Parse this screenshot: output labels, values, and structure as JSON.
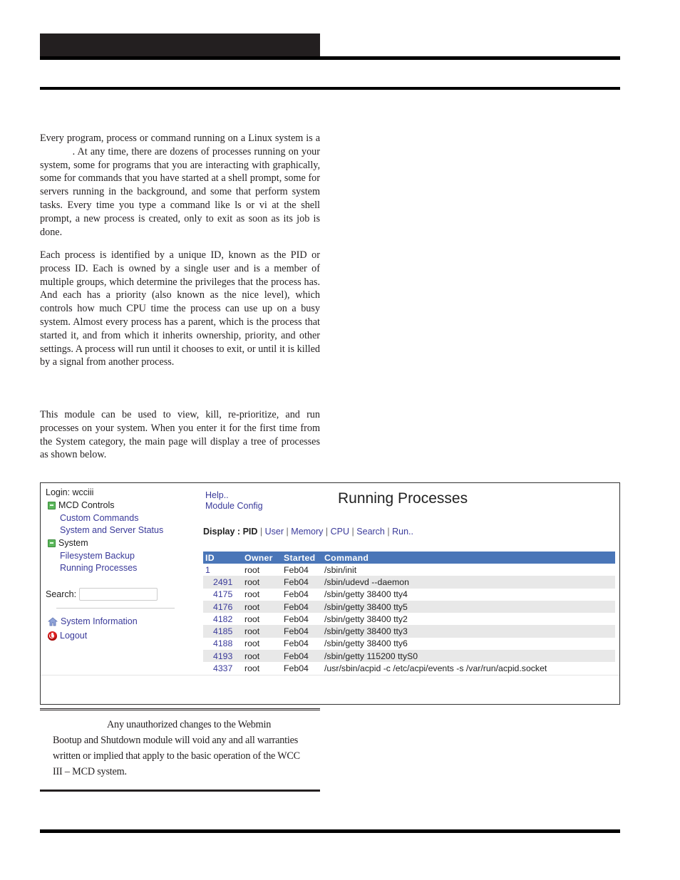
{
  "document": {
    "paragraphs": [
      "Every program, process or command running on a Linux system is a            . At any time, there are dozens of processes running on your system, some for programs that you are interacting with graphically, some for commands that you have started at a shell prompt, some for servers running in the background, and some that perform system tasks. Every time you type a command like ls or vi at the shell prompt, a new process is created, only to exit as soon as its job is done.",
      "Each process is identified by a unique ID, known as the PID or process ID. Each is owned by a single user and is a member of multiple groups, which determine the privileges that the process has. And each has a priority (also known as the nice level), which controls how much CPU time the process can use up on a busy system. Almost every process has a parent, which is the process that started it, and from which it inherits ownership, priority, and other settings. A process will run until it chooses to exit, or until it is killed by a signal from another process.",
      "This module can be used to view, kill, re-prioritize, and run processes on your system. When you enter it for the first time from the System category, the main page will display a tree of processes as shown below."
    ],
    "note": {
      "line1": "Any unauthorized changes to the Webmin",
      "rest": "Bootup and Shutdown module will void any and all warranties written or implied that apply to the basic operation of the WCC III – MCD system."
    }
  },
  "screenshot": {
    "sidebar": {
      "login": "Login: wcciii",
      "categories": [
        {
          "label": "MCD Controls",
          "icon": "expand-box-icon",
          "items": [
            "Custom Commands",
            "System and Server Status"
          ]
        },
        {
          "label": "System",
          "icon": "expand-box-icon",
          "items": [
            "Filesystem Backup",
            "Running Processes"
          ]
        }
      ],
      "search_label": "Search:",
      "search_value": "",
      "system_information": "System Information",
      "logout": "Logout"
    },
    "main": {
      "help": "Help..",
      "module_config": "Module Config",
      "title": "Running Processes",
      "display_label": "Display :",
      "display_current": "PID",
      "display_links": [
        "User",
        "Memory",
        "CPU",
        "Search",
        "Run.."
      ],
      "table": {
        "headers": [
          "ID",
          "Owner",
          "Started",
          "Command"
        ],
        "rows": [
          {
            "id": "1",
            "owner": "root",
            "started": "Feb04",
            "command": "/sbin/init",
            "child": false
          },
          {
            "id": "2491",
            "owner": "root",
            "started": "Feb04",
            "command": "/sbin/udevd --daemon",
            "child": true
          },
          {
            "id": "4175",
            "owner": "root",
            "started": "Feb04",
            "command": "/sbin/getty 38400 tty4",
            "child": true
          },
          {
            "id": "4176",
            "owner": "root",
            "started": "Feb04",
            "command": "/sbin/getty 38400 tty5",
            "child": true
          },
          {
            "id": "4182",
            "owner": "root",
            "started": "Feb04",
            "command": "/sbin/getty 38400 tty2",
            "child": true
          },
          {
            "id": "4185",
            "owner": "root",
            "started": "Feb04",
            "command": "/sbin/getty 38400 tty3",
            "child": true
          },
          {
            "id": "4188",
            "owner": "root",
            "started": "Feb04",
            "command": "/sbin/getty 38400 tty6",
            "child": true
          },
          {
            "id": "4193",
            "owner": "root",
            "started": "Feb04",
            "command": "/sbin/getty 115200 ttyS0",
            "child": true
          },
          {
            "id": "4337",
            "owner": "root",
            "started": "Feb04",
            "command": "/usr/sbin/acpid -c /etc/acpi/events -s /var/run/acpid.socket",
            "child": true
          }
        ]
      }
    },
    "colors": {
      "header_blue": "#4a76b8",
      "link": "#3a3a9a",
      "row_alt": "#e8e8e8"
    }
  }
}
